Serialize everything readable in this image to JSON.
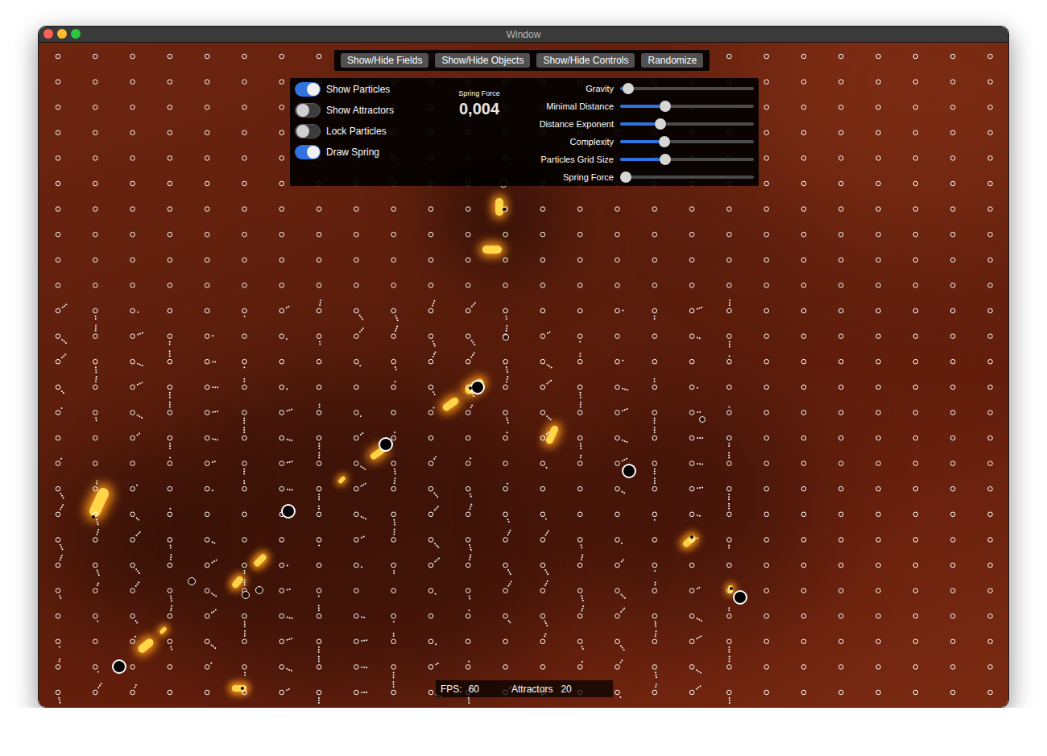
{
  "window": {
    "title": "Window"
  },
  "toolbar": {
    "buttons": [
      "Show/Hide Fields",
      "Show/Hide Objects",
      "Show/Hide Controls",
      "Randomize"
    ]
  },
  "controls": {
    "toggles": [
      {
        "label": "Show Particles",
        "on": true
      },
      {
        "label": "Show Attractors",
        "on": false
      },
      {
        "label": "Lock Particles",
        "on": false
      },
      {
        "label": "Draw Spring",
        "on": true
      }
    ],
    "readout": {
      "label": "Spring Force",
      "value": "0,004"
    },
    "sliders": [
      {
        "label": "Gravity",
        "level": 0.06
      },
      {
        "label": "Minimal Distance",
        "level": 0.34
      },
      {
        "label": "Distance Exponent",
        "level": 0.3
      },
      {
        "label": "Complexity",
        "level": 0.33
      },
      {
        "label": "Particles Grid Size",
        "level": 0.34
      },
      {
        "label": "Spring Force",
        "level": 0.04
      }
    ]
  },
  "status_bar": {
    "fps_label": "FPS:",
    "fps": "60",
    "attractors_label": "Attractors",
    "attractors": "20"
  }
}
